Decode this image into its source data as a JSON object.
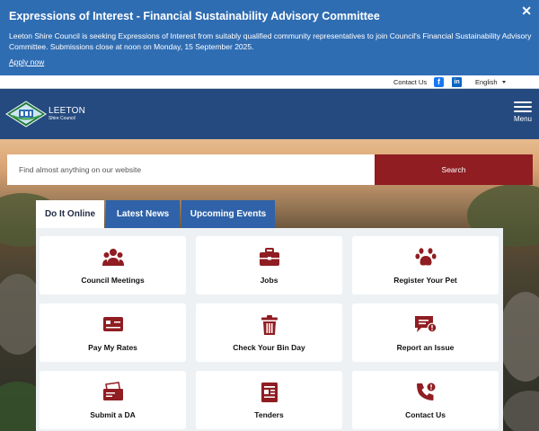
{
  "alert": {
    "title": "Expressions of Interest - Financial Sustainability Advisory Committee",
    "body": "Leeton Shire Council is seeking Expressions of Interest from suitably qualified community representatives to join Council's Financial Sustainability Advisory Committee. Submissions close at noon on Monday, 15 September 2025.",
    "link": "Apply now",
    "close": "✕"
  },
  "utility": {
    "contact": "Contact Us",
    "language": "English",
    "social": [
      "facebook-icon",
      "linkedin-icon"
    ]
  },
  "header": {
    "logo_name": "LEETON",
    "logo_sub": "Shire Council",
    "menu_label": "Menu"
  },
  "search": {
    "placeholder": "Find almost anything on our website",
    "button": "Search"
  },
  "tabs": [
    {
      "label": "Do It Online",
      "active": true
    },
    {
      "label": "Latest News",
      "active": false
    },
    {
      "label": "Upcoming Events",
      "active": false
    }
  ],
  "cards": [
    {
      "label": "Council Meetings",
      "icon": "people-icon"
    },
    {
      "label": "Jobs",
      "icon": "briefcase-icon"
    },
    {
      "label": "Register Your Pet",
      "icon": "paw-icon"
    },
    {
      "label": "Pay My Rates",
      "icon": "credit-card-icon"
    },
    {
      "label": "Check Your Bin Day",
      "icon": "bin-icon"
    },
    {
      "label": "Report an Issue",
      "icon": "alert-chat-icon"
    },
    {
      "label": "Submit a DA",
      "icon": "document-icon"
    },
    {
      "label": "Tenders",
      "icon": "newspaper-icon"
    },
    {
      "label": "Contact Us",
      "icon": "phone-icon"
    }
  ],
  "colors": {
    "alert_bg": "#2f6db3",
    "header_bg": "#254a7f",
    "accent_red": "#8f1d22",
    "tab_blue": "#2f62a8"
  }
}
